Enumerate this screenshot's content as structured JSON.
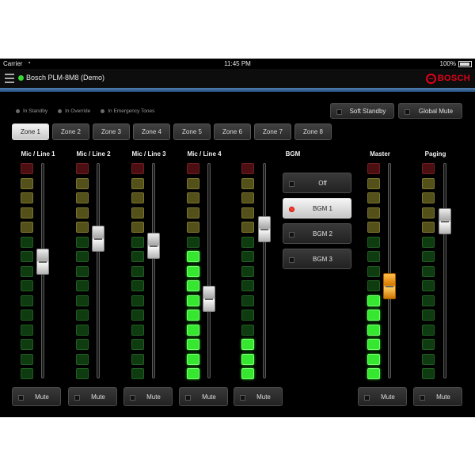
{
  "status_bar": {
    "carrier": "Carrier",
    "wifi_icon": "wifi-icon",
    "time": "11:45 PM",
    "battery": "100%"
  },
  "header": {
    "title": "Bosch PLM-8M8 (Demo)",
    "logo_text": "BOSCH",
    "accent": "#e2001a",
    "online_color": "#36d936"
  },
  "indicators": [
    {
      "label": "In Standby"
    },
    {
      "label": "In Override"
    },
    {
      "label": "In Emergency Tones"
    }
  ],
  "top_buttons": {
    "soft_standby": "Soft Standby",
    "global_mute": "Global Mute"
  },
  "zones": [
    {
      "label": "Zone 1",
      "active": true
    },
    {
      "label": "Zone 2"
    },
    {
      "label": "Zone 3"
    },
    {
      "label": "Zone 4"
    },
    {
      "label": "Zone 5"
    },
    {
      "label": "Zone 6"
    },
    {
      "label": "Zone 7"
    },
    {
      "label": "Zone 8"
    }
  ],
  "channels": [
    {
      "label": "Mic / Line 1",
      "mute": "Mute",
      "level_lit": 0,
      "fader": 0.55
    },
    {
      "label": "Mic / Line 2",
      "mute": "Mute",
      "level_lit": 0,
      "fader": 0.67
    },
    {
      "label": "Mic / Line 3",
      "mute": "Mute",
      "level_lit": 0,
      "fader": 0.63
    },
    {
      "label": "Mic / Line 4",
      "mute": "Mute",
      "level_lit": 9,
      "fader": 0.35
    },
    {
      "label": "",
      "mute": "Mute",
      "level_lit": 3,
      "fader": 0.72
    },
    {
      "label": "Master",
      "mute": "Mute",
      "level_lit": 6,
      "fader": 0.42,
      "knob_color": "orange"
    },
    {
      "label": "Paging",
      "mute": "Mute",
      "level_lit": 0,
      "fader": 0.76
    }
  ],
  "bgm": {
    "label": "BGM",
    "options": [
      "Off",
      "BGM 1",
      "BGM 2",
      "BGM 3"
    ],
    "selected": "BGM 1"
  }
}
